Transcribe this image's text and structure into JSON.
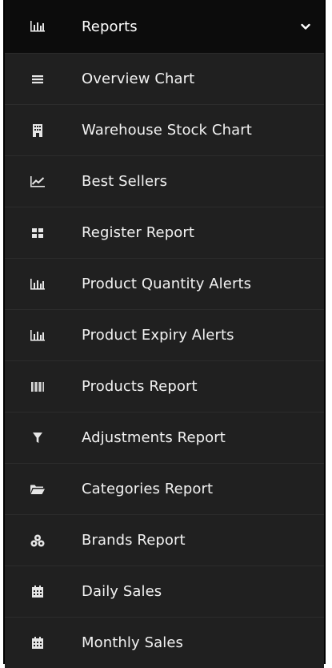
{
  "menu": {
    "header": {
      "label": "Reports",
      "icon": "bar-chart-icon"
    },
    "items": [
      {
        "label": "Overview Chart",
        "icon": "list-icon"
      },
      {
        "label": "Warehouse Stock Chart",
        "icon": "building-icon"
      },
      {
        "label": "Best Sellers",
        "icon": "line-chart-icon"
      },
      {
        "label": "Register Report",
        "icon": "grid-icon"
      },
      {
        "label": "Product Quantity Alerts",
        "icon": "bar-chart-icon"
      },
      {
        "label": "Product Expiry Alerts",
        "icon": "bar-chart-icon"
      },
      {
        "label": "Products Report",
        "icon": "barcode-icon"
      },
      {
        "label": "Adjustments Report",
        "icon": "filter-icon"
      },
      {
        "label": "Categories Report",
        "icon": "folder-open-icon"
      },
      {
        "label": "Brands Report",
        "icon": "cubes-icon"
      },
      {
        "label": "Daily Sales",
        "icon": "calendar-icon"
      },
      {
        "label": "Monthly Sales",
        "icon": "calendar-icon"
      }
    ]
  },
  "colors": {
    "header_bg": "#0c0c0c",
    "item_bg": "#202020",
    "text": "#f2f2f2",
    "icon": "#e6e6e6"
  }
}
